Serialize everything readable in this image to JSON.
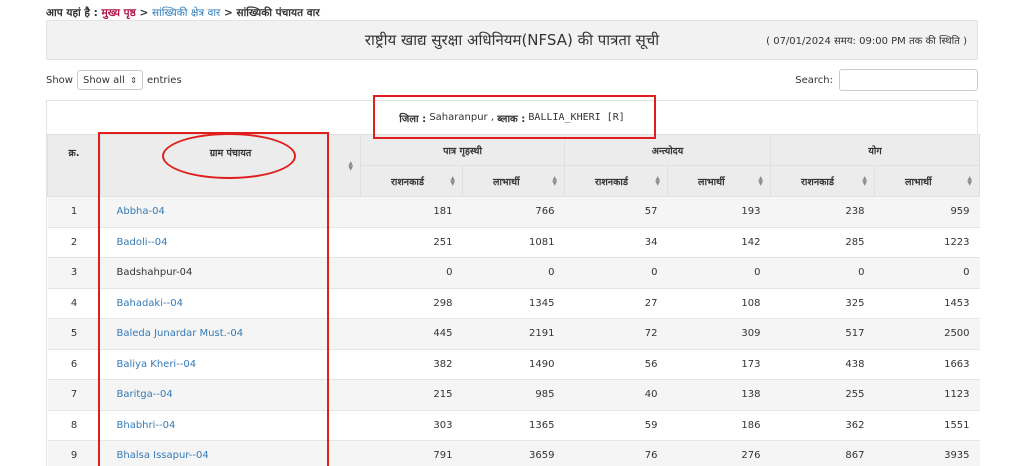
{
  "breadcrumb": {
    "prefix": "आप यहां है :",
    "home": "मुख्य पृष्ठ",
    "sep1": ">",
    "mid": "सांख्यिकी क्षेत्र वार",
    "sep2": ">",
    "current": "सांख्यिकी पंचायत वार"
  },
  "header": {
    "title": "राष्ट्रीय खाद्य सुरक्षा अधिनियम(NFSA) की पात्रता सूची",
    "status": "( 07/01/2024 समय: 09:00 PM तक की स्थिति )"
  },
  "controls": {
    "show_label": "Show",
    "show_value": "Show all",
    "entries_label": "entries",
    "search_label": "Search:",
    "search_value": ""
  },
  "filter": {
    "district_label": "जिला :",
    "district_value": "Saharanpur ,",
    "block_label": "ब्लाक :",
    "block_value": "BALLIA_KHERI [R]"
  },
  "table": {
    "headers": {
      "serial": "क्र.",
      "gram": "ग्राम पंचायत",
      "group1": "पात्र गृहस्थी",
      "group2": "अन्त्योदय",
      "group3": "योग",
      "rationcard": "राशनकार्ड",
      "beneficiary": "लाभार्थी"
    },
    "rows": [
      {
        "sr": "1",
        "name": "Abbha-04",
        "link": true,
        "c1": "181",
        "c2": "766",
        "c3": "57",
        "c4": "193",
        "c5": "238",
        "c6": "959"
      },
      {
        "sr": "2",
        "name": "Badoli--04",
        "link": true,
        "c1": "251",
        "c2": "1081",
        "c3": "34",
        "c4": "142",
        "c5": "285",
        "c6": "1223"
      },
      {
        "sr": "3",
        "name": "Badshahpur-04",
        "link": false,
        "c1": "0",
        "c2": "0",
        "c3": "0",
        "c4": "0",
        "c5": "0",
        "c6": "0"
      },
      {
        "sr": "4",
        "name": "Bahadaki--04",
        "link": true,
        "c1": "298",
        "c2": "1345",
        "c3": "27",
        "c4": "108",
        "c5": "325",
        "c6": "1453"
      },
      {
        "sr": "5",
        "name": "Baleda Junardar Must.-04",
        "link": true,
        "c1": "445",
        "c2": "2191",
        "c3": "72",
        "c4": "309",
        "c5": "517",
        "c6": "2500"
      },
      {
        "sr": "6",
        "name": "Baliya Kheri--04",
        "link": true,
        "c1": "382",
        "c2": "1490",
        "c3": "56",
        "c4": "173",
        "c5": "438",
        "c6": "1663"
      },
      {
        "sr": "7",
        "name": "Baritga--04",
        "link": true,
        "c1": "215",
        "c2": "985",
        "c3": "40",
        "c4": "138",
        "c5": "255",
        "c6": "1123"
      },
      {
        "sr": "8",
        "name": "Bhabhri--04",
        "link": true,
        "c1": "303",
        "c2": "1365",
        "c3": "59",
        "c4": "186",
        "c5": "362",
        "c6": "1551"
      },
      {
        "sr": "9",
        "name": "Bhalsa Issapur--04",
        "link": true,
        "c1": "791",
        "c2": "3659",
        "c3": "76",
        "c4": "276",
        "c5": "867",
        "c6": "3935"
      }
    ]
  },
  "colors": {
    "annotation": "#e01e1e",
    "link": "#337ab7",
    "home_link": "#b0174a"
  },
  "icons": {
    "sort": "sort-icon",
    "dropdown": "chevron-updown-icon"
  }
}
